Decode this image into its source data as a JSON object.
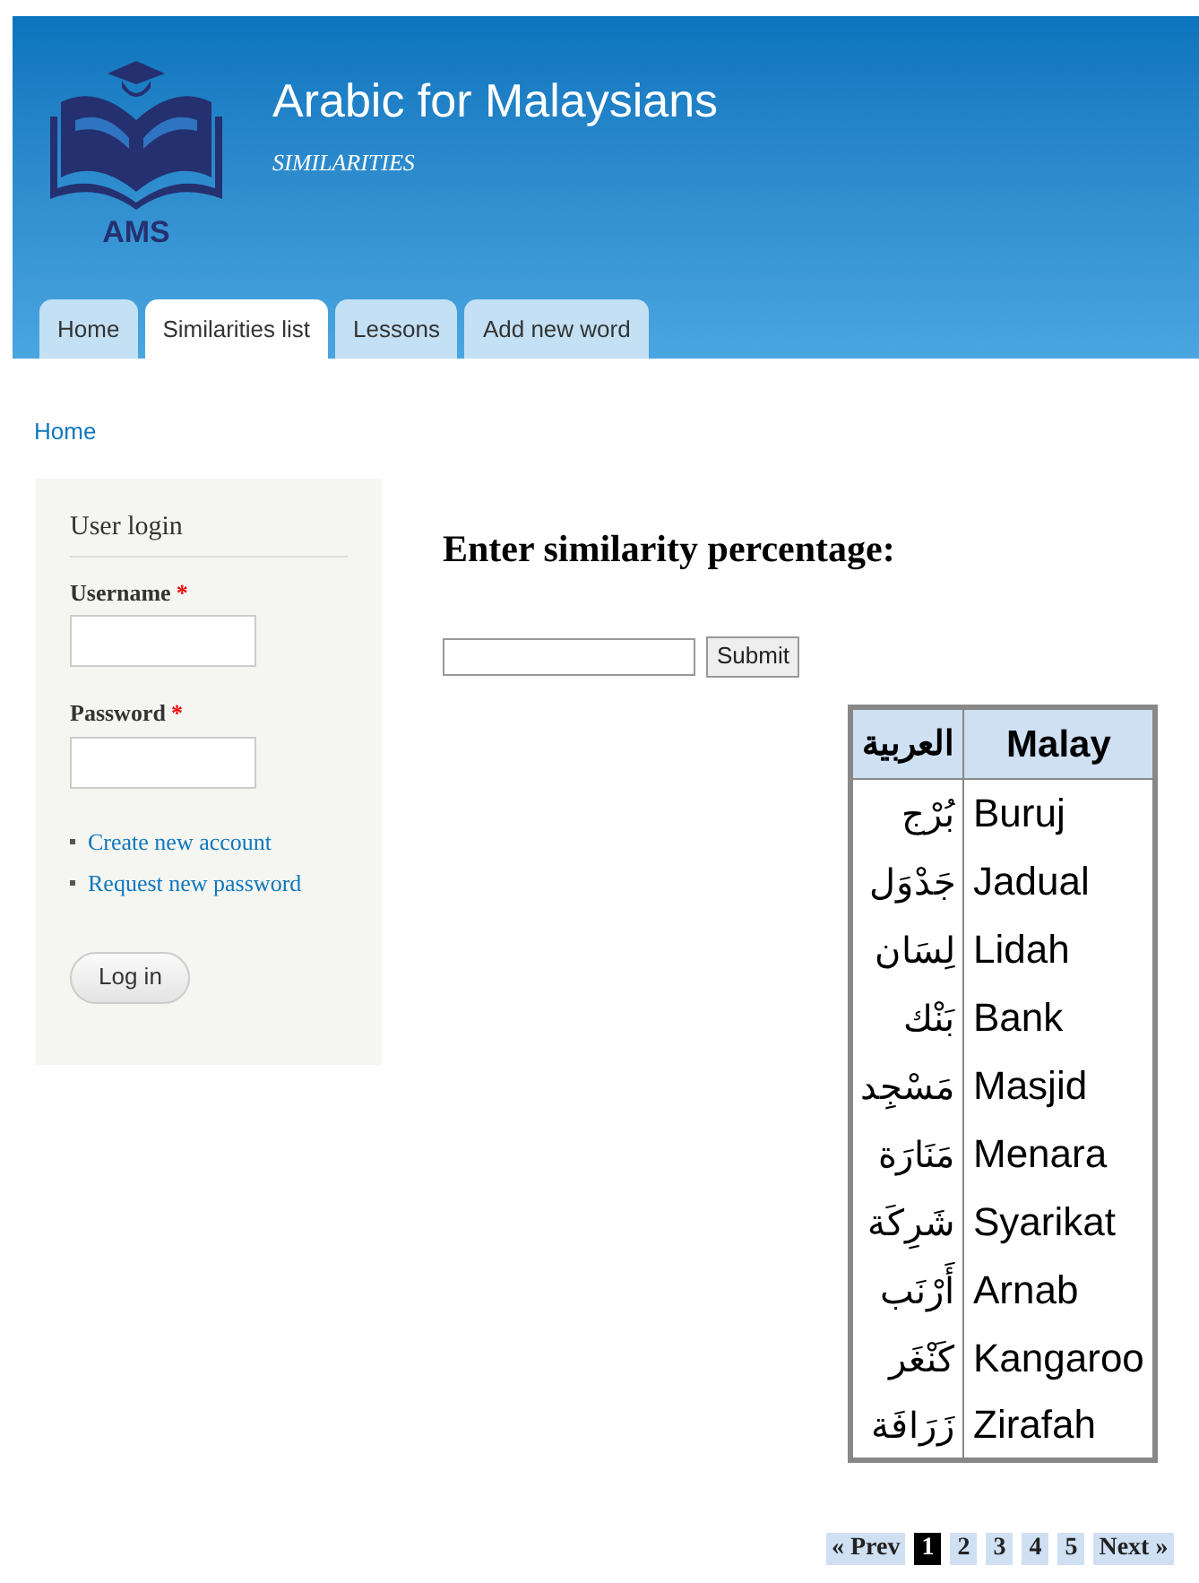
{
  "site": {
    "logo_text": "AMS",
    "name": "Arabic for Malaysians",
    "slogan": "SIMILARITIES"
  },
  "tabs": [
    {
      "label": "Home",
      "selected": false
    },
    {
      "label": "Similarities list",
      "selected": true
    },
    {
      "label": "Lessons",
      "selected": false
    },
    {
      "label": "Add new word",
      "selected": false
    }
  ],
  "breadcrumb": "Home",
  "login": {
    "title": "User login",
    "fields": [
      {
        "label": "Username",
        "required_mark": "*"
      },
      {
        "label": "Password",
        "required_mark": "*"
      }
    ],
    "links": [
      "Create new account",
      "Request new password"
    ],
    "button": "Log in"
  },
  "form": {
    "heading": "Enter similarity percentage:",
    "button": "Submit"
  },
  "table": {
    "columns": [
      "العربية",
      "Malay"
    ],
    "rows": [
      [
        "بُرْج",
        "Buruj"
      ],
      [
        "جَدْوَل",
        "Jadual"
      ],
      [
        "لِسَان",
        "Lidah"
      ],
      [
        "بَنْك",
        "Bank"
      ],
      [
        "مَسْجِد",
        "Masjid"
      ],
      [
        "مَنَارَة",
        "Menara"
      ],
      [
        "شَرِكَة",
        "Syarikat"
      ],
      [
        "أَرْنَب",
        "Arnab"
      ],
      [
        "كَنْغَر",
        "Kangaroo"
      ],
      [
        "زَرَافَة",
        "Zirafah"
      ]
    ]
  },
  "pager": {
    "prev": "« Prev",
    "pages": [
      {
        "label": "1",
        "selected": true
      },
      {
        "label": "2",
        "selected": false
      },
      {
        "label": "3",
        "selected": false
      },
      {
        "label": "4",
        "selected": false
      },
      {
        "label": "5",
        "selected": false
      }
    ],
    "next": "Next »"
  }
}
